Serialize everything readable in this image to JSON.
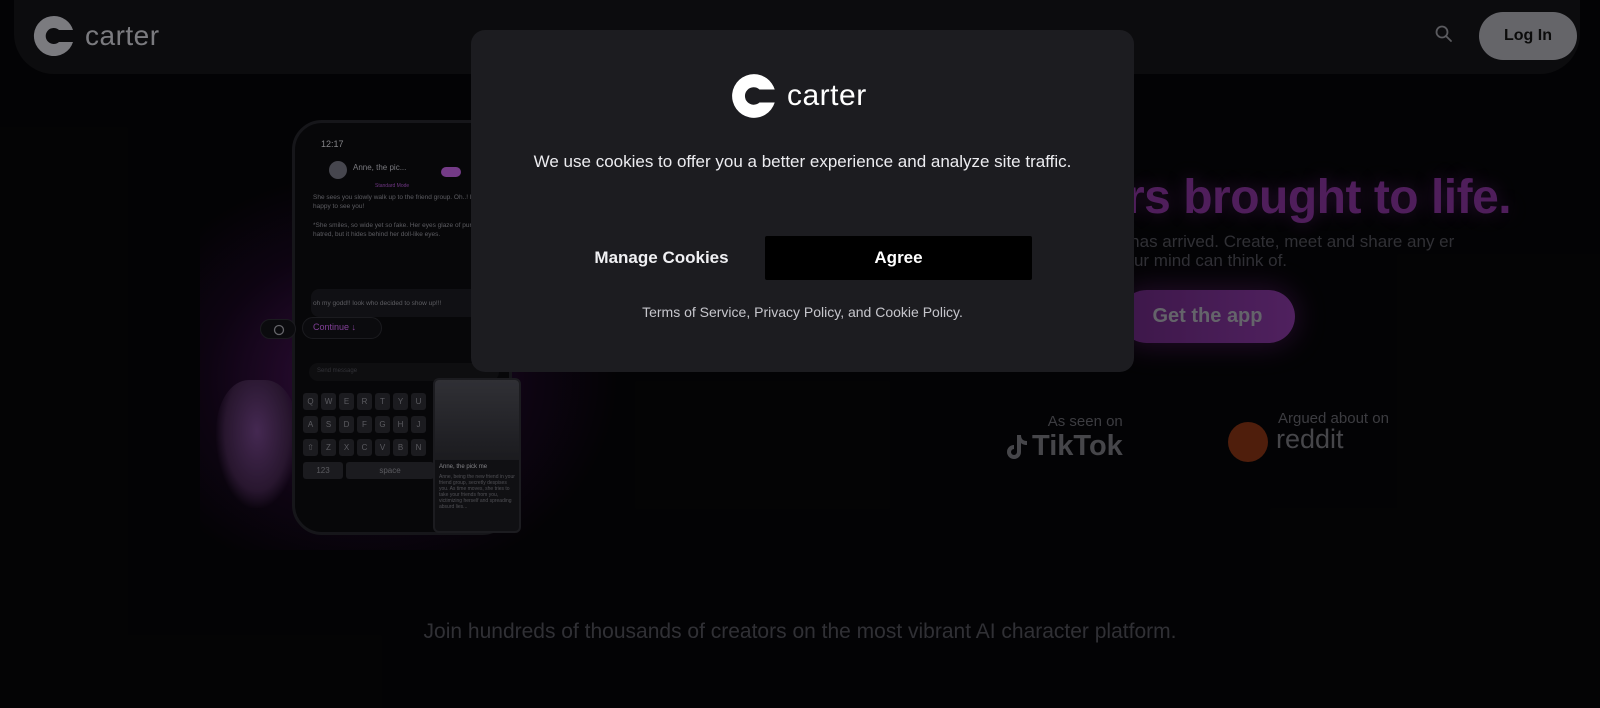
{
  "header": {
    "brand_name": "carter",
    "search_icon": "search-icon",
    "login_label": "Log In"
  },
  "phone": {
    "time": "12:17",
    "chat_name": "Anne, the pic...",
    "mode_label": "Standard Mode",
    "message_1": "She sees you slowly walk up to the friend group. Oh..! It's so happy to see you!",
    "message_2": "*She smiles, so wide yet so fake. Her eyes glaze of pure hatred, but it hides behind her doll-like eyes.",
    "message_3": "oh my godd!! look who decided to show up!!!",
    "continue_label": "Continue ↓",
    "send_placeholder": "Send message",
    "keyboard_rows": [
      [
        "Q",
        "W",
        "E",
        "R",
        "T",
        "Y",
        "U"
      ],
      [
        "A",
        "S",
        "D",
        "F",
        "G",
        "H",
        "J"
      ],
      [
        "⇧",
        "Z",
        "X",
        "C",
        "V",
        "B",
        "N"
      ]
    ],
    "key_123": "123",
    "key_space": "space",
    "card_caption": "Anne, the pick me",
    "card_desc": "Anne, being the new friend in your friend group, secretly despises you. As time moves, she tries to take your friends from you, victimizing herself and spreading absurd lies..."
  },
  "hero": {
    "title": "rs brought to life.",
    "subtitle": "g has arrived. Create, meet and share any er your mind can think of.",
    "cta_label": "Get the app"
  },
  "press": {
    "tiktok_label": "As seen on",
    "tiktok_word": "TikTok",
    "reddit_label": "Argued about on",
    "reddit_word": "reddit"
  },
  "tagline": "Join hundreds of thousands of creators on the most vibrant AI character platform.",
  "cookie_modal": {
    "brand_name": "carter",
    "message": "We use cookies to offer you a better experience and analyze site traffic.",
    "manage_label": "Manage Cookies",
    "agree_label": "Agree",
    "terms_label": "Terms of Service",
    "separator_1": ", ",
    "privacy_label": "Privacy Policy",
    "separator_2": ", and ",
    "cookie_policy_label": "Cookie Policy",
    "end_punct": "."
  },
  "colors": {
    "accent": "#b35bd0",
    "modal_bg": "#1c1c20",
    "agree_bg": "#000000"
  }
}
